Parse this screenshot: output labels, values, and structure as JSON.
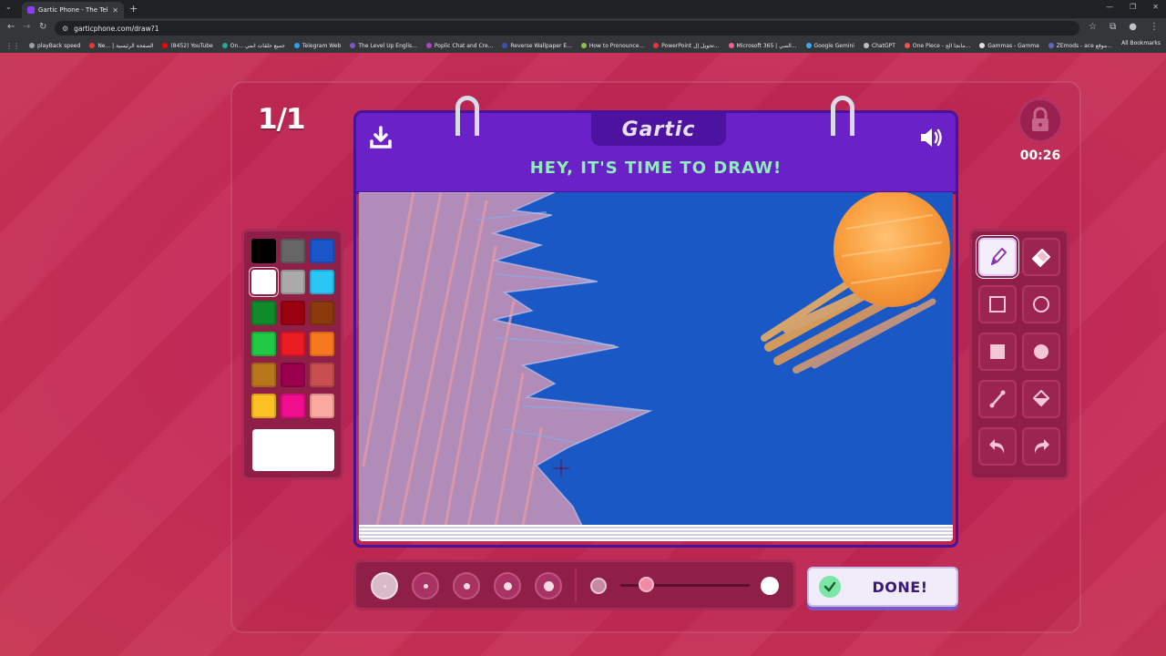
{
  "browser": {
    "tab_title": "Gartic Phone - The Telephone G",
    "url": "garticphone.com/draw?1",
    "bookmarks": [
      {
        "label": "playBack speed",
        "color": "#9aa0a6"
      },
      {
        "label": "Ne... | الصفحة الرئيسية",
        "color": "#e53935"
      },
      {
        "label": "(8452) YouTube",
        "color": "#ff0000"
      },
      {
        "label": "On... جميع حلقات انمي",
        "color": "#26a69a"
      },
      {
        "label": "Telegram Web",
        "color": "#2aa3ef"
      },
      {
        "label": "The Level Up Englis...",
        "color": "#7e57c2"
      },
      {
        "label": "Poplic Chat and Cre...",
        "color": "#ab47bc"
      },
      {
        "label": "Reverse Wallpaper E...",
        "color": "#3f51b5"
      },
      {
        "label": "How to Pronounce...",
        "color": "#8bc34a"
      },
      {
        "label": "PowerPoint تحويل إل...",
        "color": "#e53935"
      },
      {
        "label": "Microsoft 365 | الصي...",
        "color": "#f06292"
      },
      {
        "label": "Google Gemini",
        "color": "#42a5f5"
      },
      {
        "label": "ChatGPT",
        "color": "#bdbdbd"
      },
      {
        "label": "One Piece - مانجا الج...",
        "color": "#ef5350"
      },
      {
        "label": "Gammas - Gamma",
        "color": "#e0e0e0"
      },
      {
        "label": "ZEmods - ace موقع...",
        "color": "#5c6bc0"
      }
    ],
    "all_bookmarks": "All Bookmarks"
  },
  "game": {
    "round": "1/1",
    "logo": "Gartic",
    "banner": "HEY, IT'S TIME TO DRAW!",
    "timer": "00:26",
    "done_label": "DONE!"
  },
  "palette": {
    "colors": [
      "#000000",
      "#666666",
      "#1a56c8",
      "#ffffff",
      "#aaaaaa",
      "#2ac6f4",
      "#118a2b",
      "#990010",
      "#8a3a0c",
      "#21c846",
      "#ec1c24",
      "#f7781e",
      "#b8771c",
      "#99004e",
      "#c84f4f",
      "#fbc124",
      "#f00e8e",
      "#fba8a0"
    ],
    "selected_index": 3,
    "current_color": "#ffffff"
  },
  "tools": {
    "items": [
      "pencil-tool",
      "eraser-tool",
      "rectangle-outline-tool",
      "ellipse-outline-tool",
      "rectangle-fill-tool",
      "ellipse-fill-tool",
      "line-tool",
      "fill-bucket-tool",
      "undo-tool",
      "redo-tool"
    ],
    "active": "pencil-tool"
  },
  "brush": {
    "sizes": 5,
    "selected_size_index": 0,
    "opacity_fraction": 0.2
  }
}
